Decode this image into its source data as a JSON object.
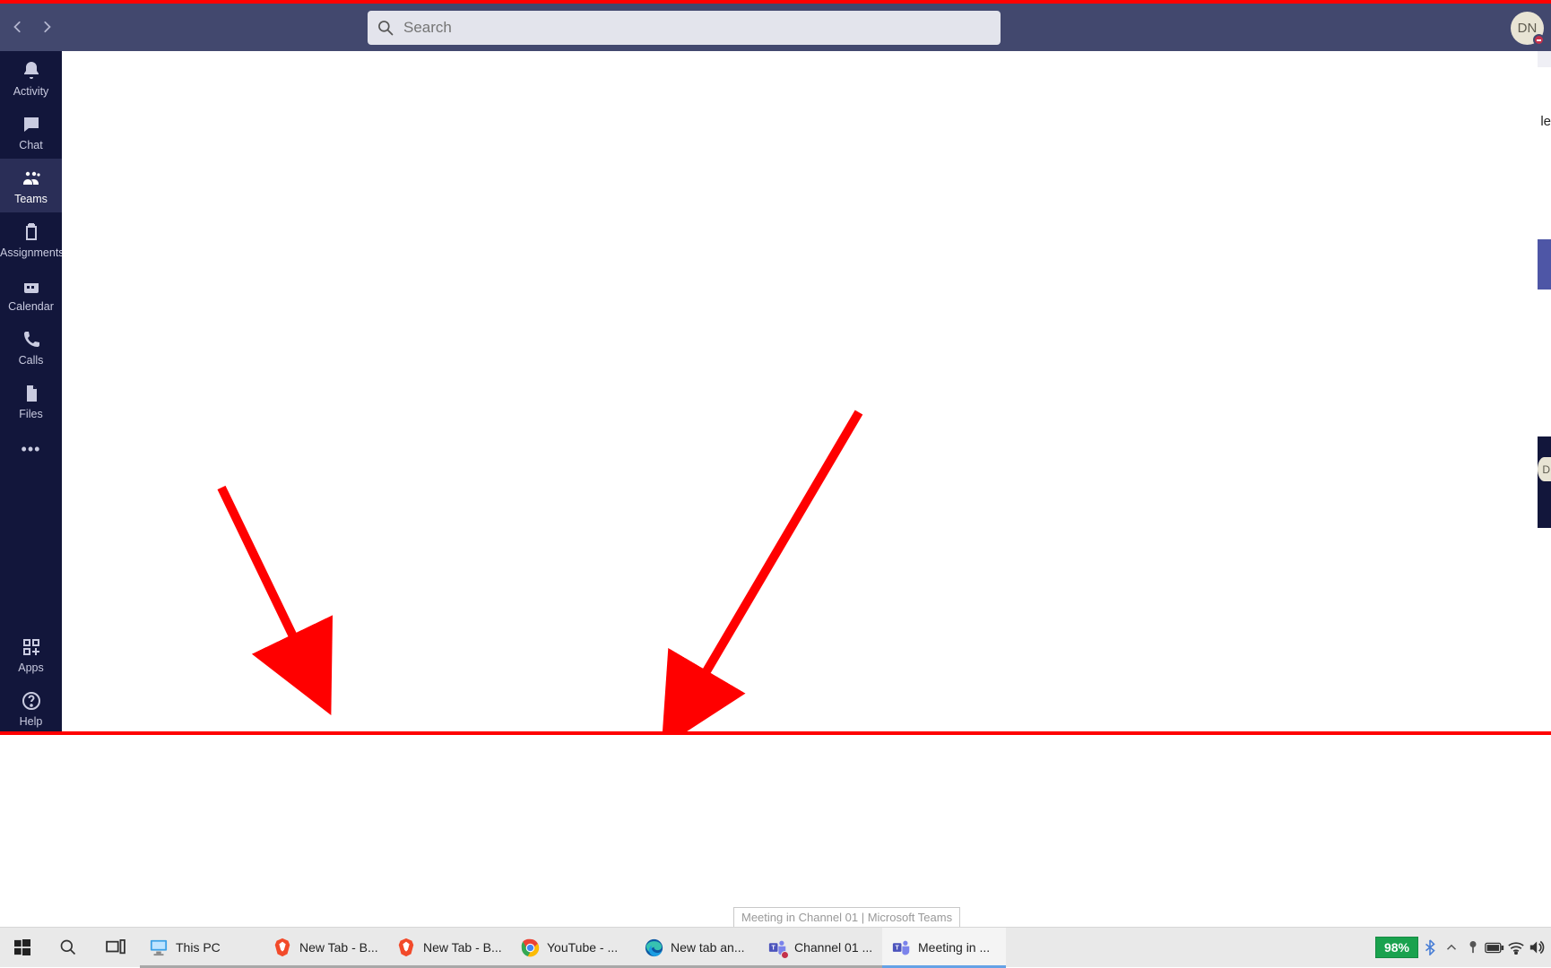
{
  "header": {
    "search_placeholder": "Search",
    "avatar_initials": "DN"
  },
  "rail": {
    "items": [
      {
        "id": "activity",
        "label": "Activity"
      },
      {
        "id": "chat",
        "label": "Chat"
      },
      {
        "id": "teams",
        "label": "Teams"
      },
      {
        "id": "assignments",
        "label": "Assignments"
      },
      {
        "id": "calendar",
        "label": "Calendar"
      },
      {
        "id": "calls",
        "label": "Calls"
      },
      {
        "id": "files",
        "label": "Files"
      }
    ],
    "active_id": "teams",
    "apps_label": "Apps",
    "help_label": "Help"
  },
  "right_clip": {
    "partial_text": "le",
    "avatar_fragment": "D"
  },
  "taskbar": {
    "tooltip_fragment": "Meeting in  Channel 01  | Microsoft Teams",
    "items": [
      {
        "id": "thispc",
        "label": "This PC",
        "icon": "monitor"
      },
      {
        "id": "brave1",
        "label": "New Tab - B...",
        "icon": "brave"
      },
      {
        "id": "brave2",
        "label": "New Tab - B...",
        "icon": "brave"
      },
      {
        "id": "chrome",
        "label": "YouTube - ...",
        "icon": "chrome"
      },
      {
        "id": "edge",
        "label": "New tab an...",
        "icon": "edge"
      },
      {
        "id": "teams1",
        "label": "Channel 01 ...",
        "icon": "teams-busy"
      },
      {
        "id": "teams2",
        "label": "Meeting in ...",
        "icon": "teams"
      }
    ],
    "battery_percent": "98%"
  }
}
